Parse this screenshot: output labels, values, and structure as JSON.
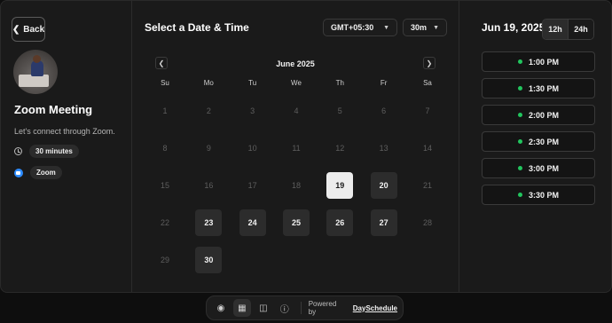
{
  "host": {
    "back_label": "Back",
    "meeting_title": "Zoom Meeting",
    "description": "Let's connect through Zoom.",
    "duration": "30 minutes",
    "platform": "Zoom"
  },
  "picker": {
    "title": "Select a Date & Time",
    "timezone": "GMT+05:30",
    "duration_option": "30m",
    "month": "June 2025",
    "weekdays": [
      "Su",
      "Mo",
      "Tu",
      "We",
      "Th",
      "Fr",
      "Sa"
    ],
    "weeks": [
      [
        {
          "d": "1",
          "s": "off"
        },
        {
          "d": "2",
          "s": "off"
        },
        {
          "d": "3",
          "s": "off"
        },
        {
          "d": "4",
          "s": "off"
        },
        {
          "d": "5",
          "s": "off"
        },
        {
          "d": "6",
          "s": "off"
        },
        {
          "d": "7",
          "s": "off"
        }
      ],
      [
        {
          "d": "8",
          "s": "off"
        },
        {
          "d": "9",
          "s": "off"
        },
        {
          "d": "10",
          "s": "off"
        },
        {
          "d": "11",
          "s": "off"
        },
        {
          "d": "12",
          "s": "off"
        },
        {
          "d": "13",
          "s": "off"
        },
        {
          "d": "14",
          "s": "off"
        }
      ],
      [
        {
          "d": "15",
          "s": "off"
        },
        {
          "d": "16",
          "s": "off"
        },
        {
          "d": "17",
          "s": "off"
        },
        {
          "d": "18",
          "s": "off"
        },
        {
          "d": "19",
          "s": "selected"
        },
        {
          "d": "20",
          "s": "avail"
        },
        {
          "d": "21",
          "s": "off"
        }
      ],
      [
        {
          "d": "22",
          "s": "off"
        },
        {
          "d": "23",
          "s": "avail"
        },
        {
          "d": "24",
          "s": "avail"
        },
        {
          "d": "25",
          "s": "avail"
        },
        {
          "d": "26",
          "s": "avail"
        },
        {
          "d": "27",
          "s": "avail"
        },
        {
          "d": "28",
          "s": "off"
        }
      ],
      [
        {
          "d": "29",
          "s": "off"
        },
        {
          "d": "30",
          "s": "avail"
        },
        {
          "d": "",
          "s": "empty"
        },
        {
          "d": "",
          "s": "empty"
        },
        {
          "d": "",
          "s": "empty"
        },
        {
          "d": "",
          "s": "empty"
        },
        {
          "d": "",
          "s": "empty"
        }
      ]
    ]
  },
  "slots_panel": {
    "date": "Jun 19, 2025",
    "format_12h": "12h",
    "format_24h": "24h",
    "slots": [
      "1:00 PM",
      "1:30 PM",
      "2:00 PM",
      "2:30 PM",
      "3:00 PM",
      "3:30 PM"
    ],
    "available_color": "#22c55e"
  },
  "footer": {
    "icons": [
      "palette-icon",
      "calendar-icon",
      "grid-icon",
      "help-icon"
    ],
    "powered_by": "Powered by",
    "brand": "DaySchedule"
  }
}
